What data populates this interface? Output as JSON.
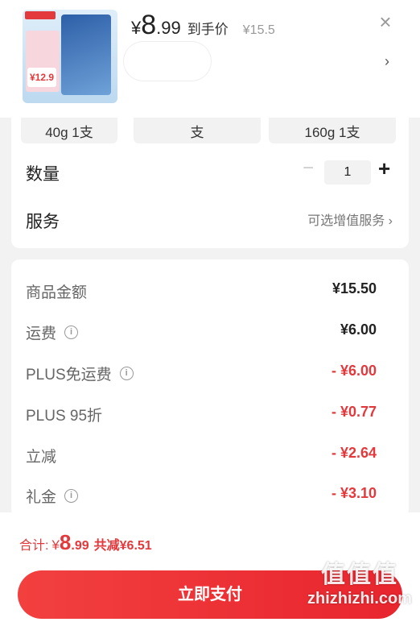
{
  "header": {
    "price_currency": "¥",
    "price_integer": "8",
    "price_decimal": ".99",
    "price_label": "到手价",
    "original_price": "¥15.5",
    "close_icon": "close-icon",
    "chevron_icon": "chevron-right-icon"
  },
  "thumbnail": {
    "price_badge": "¥12.9"
  },
  "spec_options": [
    {
      "label": "40g 1支"
    },
    {
      "label": "支"
    },
    {
      "label": "160g 1支"
    }
  ],
  "quantity": {
    "label": "数量",
    "value": "1",
    "minus": "−",
    "plus": "+"
  },
  "service": {
    "label": "服务",
    "link_text": "可选增值服务 ›"
  },
  "fees": [
    {
      "label": "商品金额",
      "value": "¥15.50",
      "info": false,
      "discount": false
    },
    {
      "label": "运费",
      "value": "¥6.00",
      "info": true,
      "discount": false
    },
    {
      "label": "PLUS免运费",
      "value": "- ¥6.00",
      "info": true,
      "discount": true
    },
    {
      "label": "PLUS 95折",
      "value": "- ¥0.77",
      "info": false,
      "discount": true
    },
    {
      "label": "立减",
      "value": "- ¥2.64",
      "info": false,
      "discount": true
    },
    {
      "label": "礼金",
      "value": "- ¥3.10",
      "info": true,
      "discount": true
    }
  ],
  "footer": {
    "total_label": "合计:",
    "total_currency": "¥",
    "total_integer": "8",
    "total_decimal": ".99",
    "savings_text": "共减¥6.51",
    "pay_button": "立即支付"
  },
  "watermark": {
    "logo": "值值值",
    "url": "zhizhizhi.com"
  },
  "colors": {
    "accent_red": "#e4393c",
    "background": "#f2f2f2"
  }
}
